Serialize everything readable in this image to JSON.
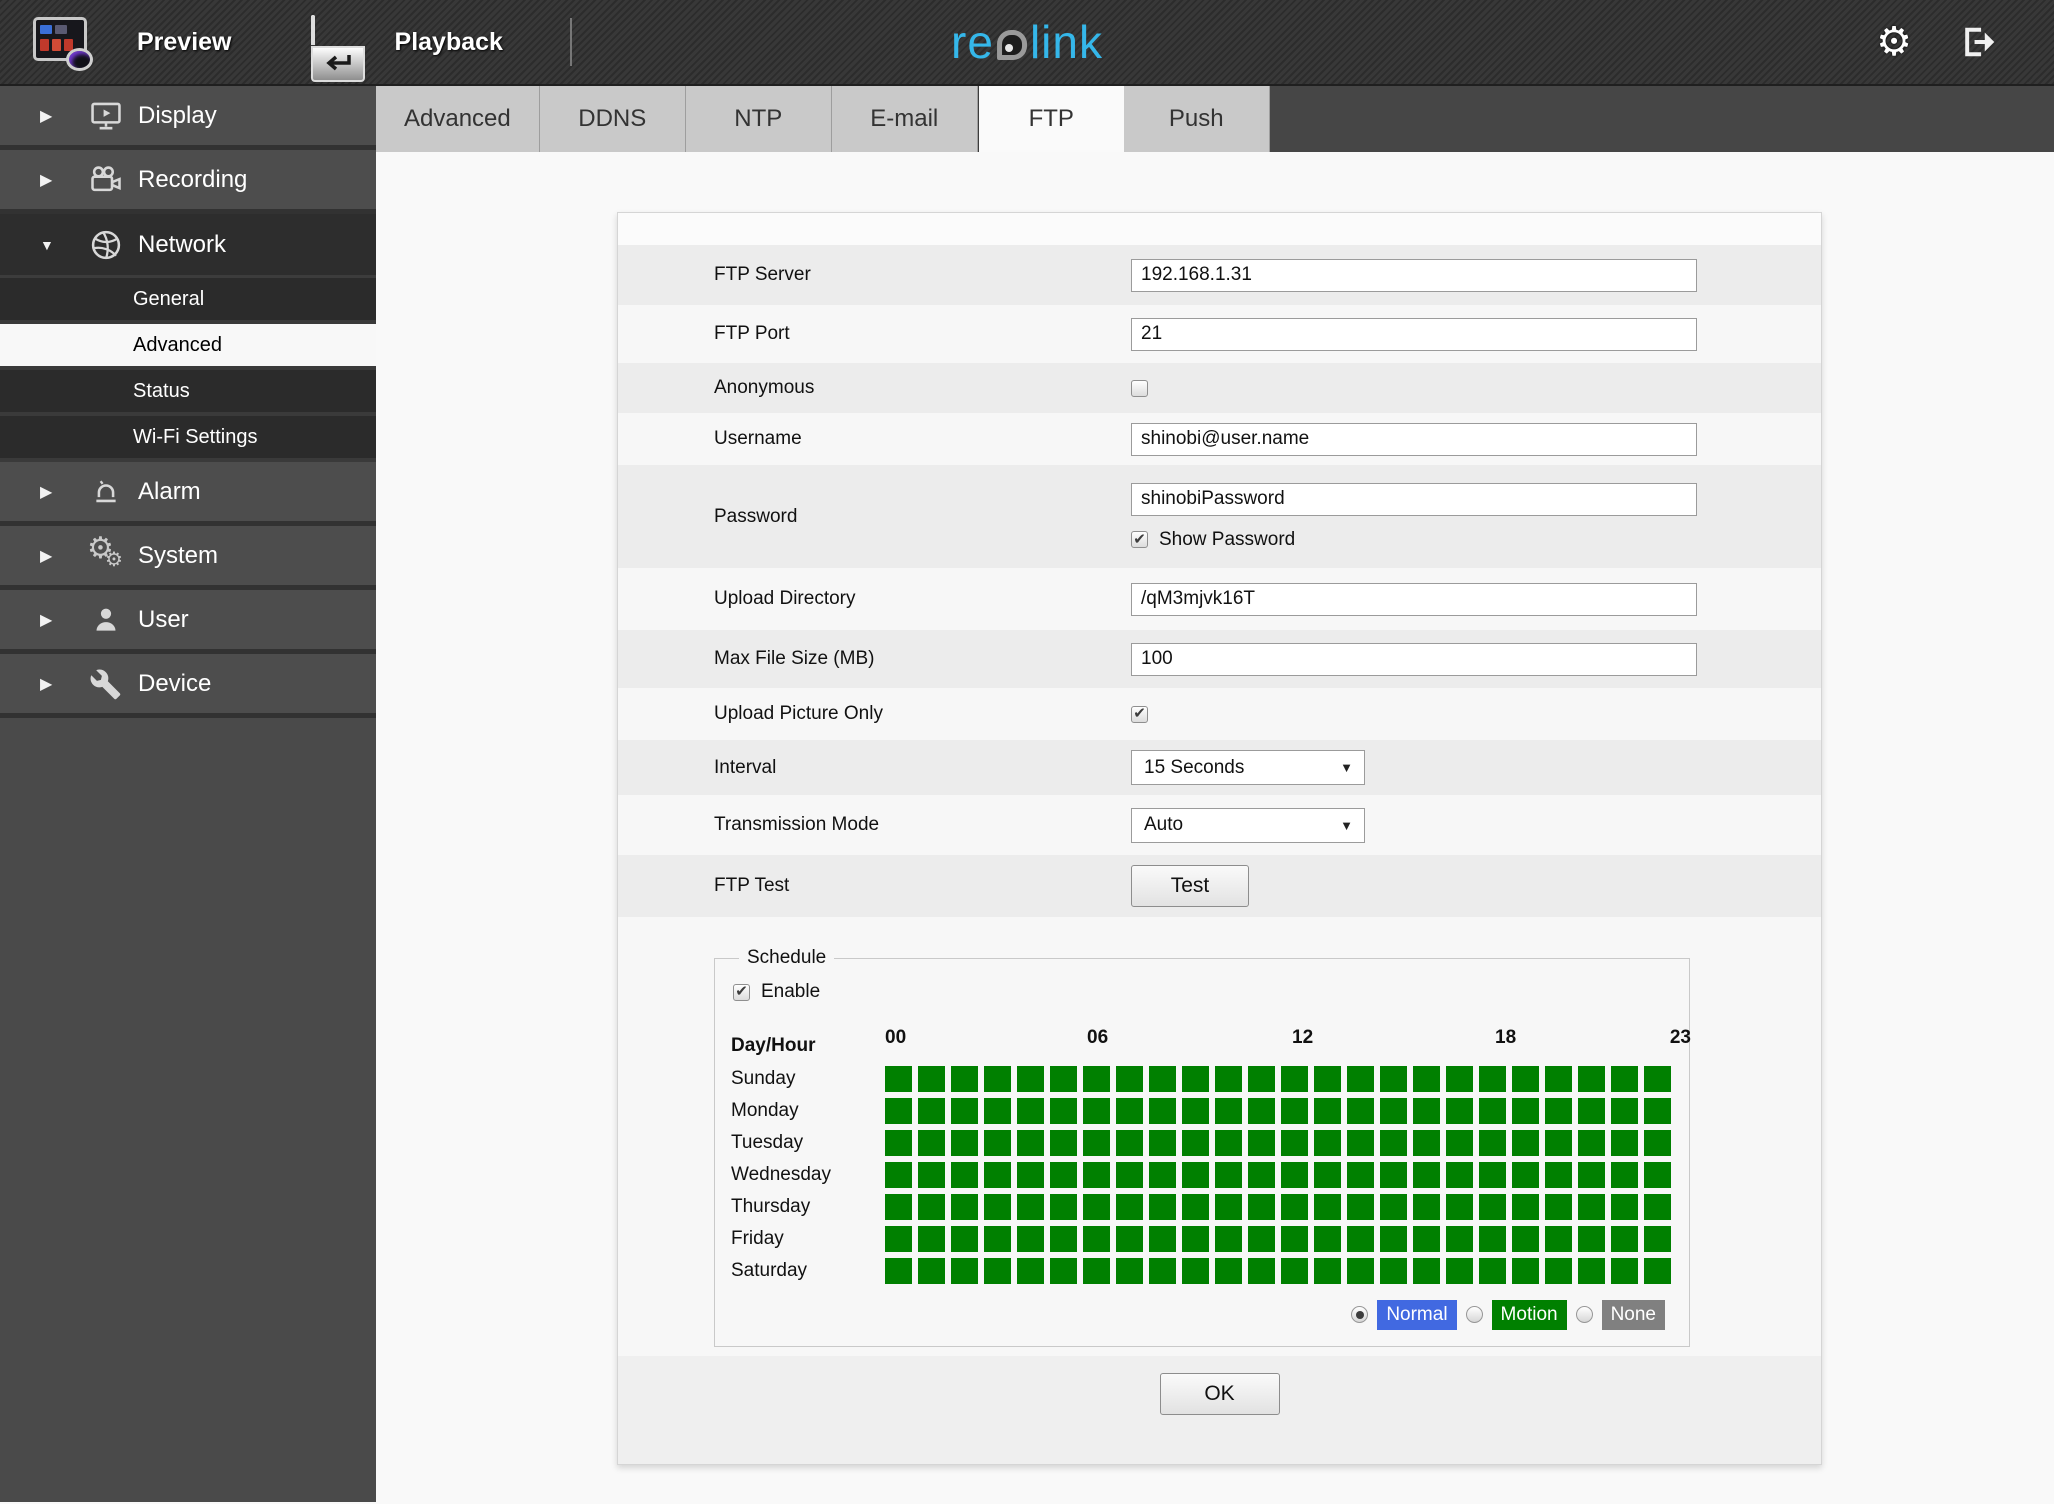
{
  "topbar": {
    "preview_label": "Preview",
    "playback_label": "Playback",
    "logo": {
      "part1": "re",
      "part2": "link",
      "color": "#35b7ea"
    }
  },
  "sidebar": {
    "items": [
      {
        "label": "Display"
      },
      {
        "label": "Recording"
      },
      {
        "label": "Network",
        "expanded": true
      },
      {
        "label": "Alarm"
      },
      {
        "label": "System"
      },
      {
        "label": "User"
      },
      {
        "label": "Device"
      }
    ],
    "network_subitems": [
      {
        "label": "General",
        "selected": false
      },
      {
        "label": "Advanced",
        "selected": true
      },
      {
        "label": "Status",
        "selected": false
      },
      {
        "label": "Wi-Fi Settings",
        "selected": false
      }
    ]
  },
  "tabbar": {
    "tabs": [
      "Advanced",
      "DDNS",
      "NTP",
      "E-mail",
      "FTP",
      "Push"
    ],
    "active_tab": "FTP"
  },
  "form": {
    "ftp_server": {
      "label": "FTP Server",
      "value": "192.168.1.31"
    },
    "ftp_port": {
      "label": "FTP Port",
      "value": "21"
    },
    "anonymous": {
      "label": "Anonymous",
      "checked": false
    },
    "username": {
      "label": "Username",
      "value": "shinobi@user.name"
    },
    "password": {
      "label": "Password",
      "value": "shinobiPassword",
      "show_password_label": "Show Password",
      "show_password_checked": true
    },
    "upload_directory": {
      "label": "Upload Directory",
      "value": "/qM3mjvk16T"
    },
    "max_file_size": {
      "label": "Max File Size (MB)",
      "value": "100"
    },
    "upload_picture_only": {
      "label": "Upload Picture Only",
      "checked": true
    },
    "interval": {
      "label": "Interval",
      "value": "15 Seconds"
    },
    "transmission_mode": {
      "label": "Transmission Mode",
      "value": "Auto"
    },
    "ftp_test": {
      "label": "FTP Test",
      "button_label": "Test"
    }
  },
  "schedule": {
    "title": "Schedule",
    "enable_label": "Enable",
    "enable_checked": true,
    "day_hour_label": "Day/Hour",
    "hour_labels": [
      "00",
      "06",
      "12",
      "18",
      "23"
    ],
    "days": [
      "Sunday",
      "Monday",
      "Tuesday",
      "Wednesday",
      "Thursday",
      "Friday",
      "Saturday"
    ],
    "columns": 24,
    "cell_color": "#008000",
    "all_cells_filled": true,
    "legend": [
      {
        "label": "Normal",
        "color": "#4169e1",
        "selected": true
      },
      {
        "label": "Motion",
        "color": "#008000",
        "selected": false
      },
      {
        "label": "None",
        "color": "#808080",
        "selected": false
      }
    ]
  },
  "ok_button_label": "OK"
}
